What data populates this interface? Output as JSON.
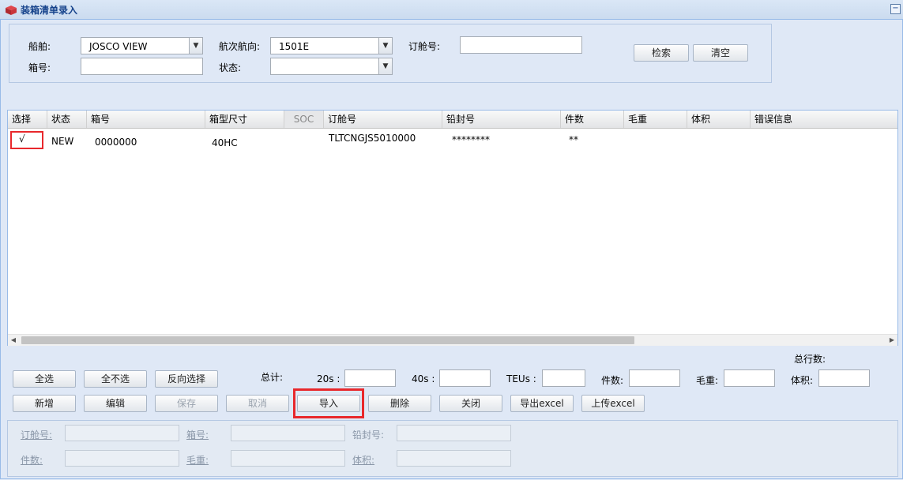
{
  "window": {
    "title": "装箱清单录入",
    "collapse_symbol": "−",
    "icon": "box-icon"
  },
  "search": {
    "vessel_label": "船舶:",
    "vessel_value": "JOSCO VIEW",
    "voyage_label": "航次航向:",
    "voyage_value": "1501E",
    "booking_label": "订舱号:",
    "booking_value": "",
    "container_label": "箱号:",
    "container_value": "",
    "status_label": "状态:",
    "status_value": "",
    "search_button": "检索",
    "clear_button": "清空"
  },
  "grid": {
    "columns": [
      "选择",
      "状态",
      "箱号",
      "箱型尺寸",
      "SOC",
      "订舱号",
      "铅封号",
      "件数",
      "毛重",
      "体积",
      "错误信息"
    ],
    "rows": [
      {
        "check": "√",
        "status": "NEW",
        "container_no": "0000000",
        "type_size": "40HC",
        "soc": "",
        "booking_no": "TLTCNGJS5010000",
        "seal_no": "********",
        "pieces": "**",
        "gross_weight": "",
        "volume": "",
        "error": ""
      }
    ],
    "scroll_left": "◀",
    "scroll_right": "▶"
  },
  "summary": {
    "total_rows_label": "总行数:",
    "total_label": "总计:",
    "s20_label": "20s :",
    "s40_label": "40s :",
    "teus_label": "TEUs :",
    "pieces_label": "件数:",
    "weight_label": "毛重:",
    "volume_label": "体积:"
  },
  "toolbar": {
    "select_all": "全选",
    "select_none": "全不选",
    "invert_selection": "反向选择",
    "add": "新增",
    "edit": "编辑",
    "save": "保存",
    "cancel": "取消",
    "import": "导入",
    "delete": "删除",
    "close": "关闭",
    "export_excel": "导出excel",
    "upload_excel": "上传excel"
  },
  "detail": {
    "booking_label": "订舱号:",
    "container_label": "箱号:",
    "seal_label": "铅封号:",
    "pieces_label": "件数:",
    "weight_label": "毛重:",
    "volume_label": "体积:"
  }
}
